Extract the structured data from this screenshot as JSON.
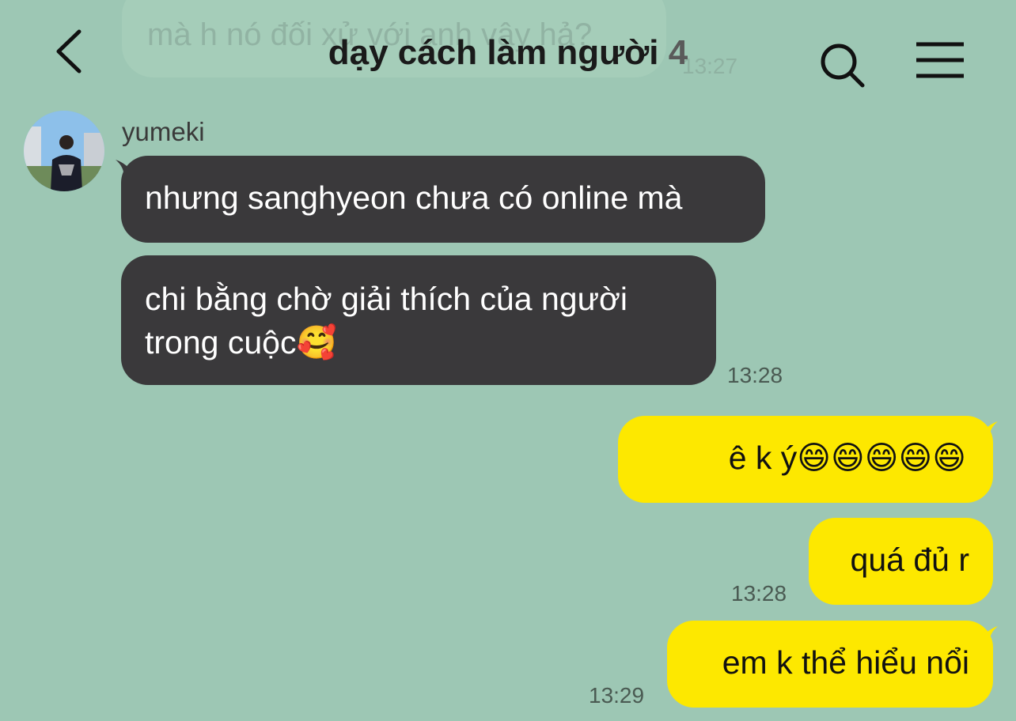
{
  "header": {
    "title": "dạy cách làm người",
    "member_count": "4"
  },
  "ghost_message": {
    "text": "mà h nó đối xử với anh vậy hả?",
    "time": "13:27"
  },
  "messages": [
    {
      "sender": "yumeki",
      "side": "in",
      "text": "nhưng sanghyeon chưa có online mà"
    },
    {
      "side": "in",
      "text_line1": "chi bằng chờ giải thích của người",
      "text_line2": "trong cuộc🥰",
      "time": "13:28"
    },
    {
      "side": "out",
      "text": "ê k ý😄😄😄😄😄"
    },
    {
      "side": "out",
      "text": "quá đủ r",
      "time": "13:28"
    },
    {
      "side": "out",
      "text": "em k thể hiểu nổi",
      "time": "13:29"
    }
  ],
  "colors": {
    "background": "#9dc7b4",
    "incoming_bubble": "#3a393b",
    "outgoing_bubble": "#fde800"
  },
  "icons": [
    "back-icon",
    "search-icon",
    "menu-icon"
  ]
}
